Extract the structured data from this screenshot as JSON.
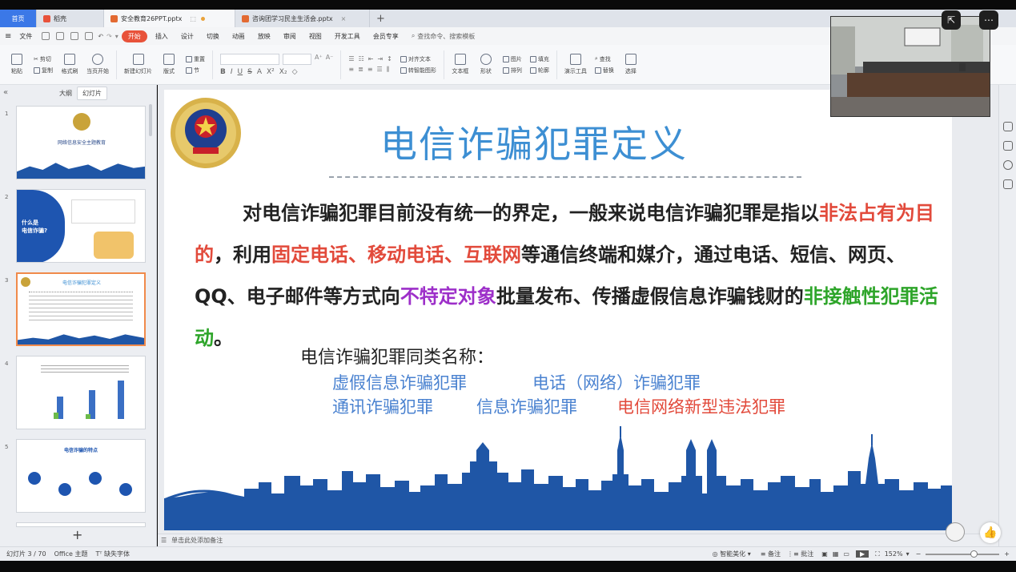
{
  "tabs": [
    {
      "label": "首页",
      "kind": "home"
    },
    {
      "label": "稻壳",
      "kind": "docer"
    },
    {
      "label": "安全教育26PPT.pptx",
      "kind": "ppt",
      "active": true
    },
    {
      "label": "咨询团学习民主生活会.pptx",
      "kind": "ppt"
    }
  ],
  "menubar": {
    "file": "文件",
    "start": "开始",
    "items": [
      "插入",
      "设计",
      "切换",
      "动画",
      "放映",
      "审阅",
      "视图",
      "开发工具",
      "会员专享"
    ],
    "search": "查找命令、搜索模板"
  },
  "ribbon": {
    "paste": "粘贴",
    "cut": "剪切",
    "copy": "复制",
    "format_painter": "格式刷",
    "play_from_current": "当页开始",
    "new_slide": "新建幻灯片",
    "layout": "版式",
    "reset": "重置",
    "section": "节",
    "textbox": "文本框",
    "shape": "形状",
    "picture": "图片",
    "arrange": "排列",
    "fill": "填充",
    "outline": "轮廓",
    "presenter_tools": "演示工具",
    "find": "查找",
    "replace": "替换",
    "select": "选择",
    "align_text": "对齐文本",
    "convert_smartart": "转智能图形",
    "format_labels": [
      "B",
      "I",
      "U",
      "S",
      "A"
    ]
  },
  "left_panel": {
    "tab_outline": "大纲",
    "tab_slides": "幻灯片",
    "thumbs": [
      {
        "num": "1",
        "title": "网络信息安全主题教育"
      },
      {
        "num": "2",
        "title": "什么是\n电信诈骗?"
      },
      {
        "num": "3",
        "title": "电信诈骗犯罪定义"
      },
      {
        "num": "4",
        "title": "电信诈骗数据"
      },
      {
        "num": "5",
        "title": "电信诈骗的特点"
      }
    ],
    "add": "+"
  },
  "slide": {
    "title": "电信诈骗犯罪定义",
    "body": {
      "p1": "对电信诈骗犯罪目前没有统一的界定，一般来说电信诈骗犯罪是指以",
      "r1": "非法占有为目的",
      "p2": "，利用",
      "r2": "固定电话、移动电话、互联网",
      "p3": "等通信终端和媒介，通过电话、短信、网页、QQ、电子邮件等方式向",
      "purple1": "不特定对象",
      "p4": "批量发布、传播虚假信息诈骗钱财的",
      "green1": "非接触性犯罪活动",
      "p5": "。"
    },
    "synonyms_title": "电信诈骗犯罪同类名称：",
    "synonyms": [
      {
        "text": "虚假信息诈骗犯罪",
        "color": "#4a82d0"
      },
      {
        "text": "电话（网络）诈骗犯罪",
        "color": "#4a82d0"
      },
      {
        "text": "通讯诈骗犯罪",
        "color": "#4a82d0"
      },
      {
        "text": "信息诈骗犯罪",
        "color": "#4a82d0"
      },
      {
        "text": "电信网络新型违法犯罪",
        "color": "#e24a3b"
      }
    ]
  },
  "notes": {
    "placeholder": "单击此处添加备注"
  },
  "statusbar": {
    "slide_counter": "幻灯片 3 / 70",
    "theme": "Office 主题",
    "missing_font": "缺失字体",
    "smart_beautify": "智能美化",
    "notes": "备注",
    "comments": "批注",
    "zoom": "152%"
  },
  "colors": {
    "accent_blue": "#3d8fd3",
    "highlight_red": "#e24a3b",
    "highlight_purple": "#9d2fc9",
    "highlight_green": "#2ea52a",
    "skyline": "#1f56a6",
    "start_tab": "#e8523a"
  }
}
